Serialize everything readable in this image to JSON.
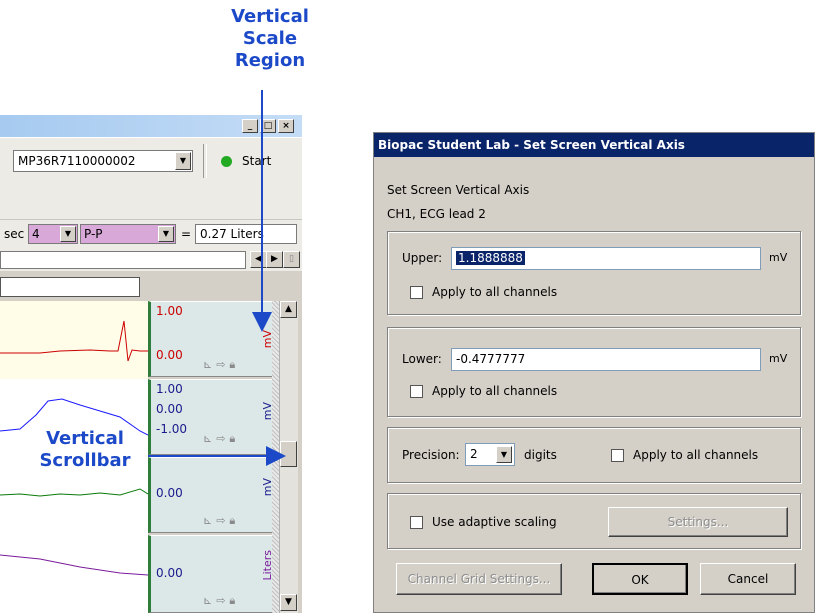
{
  "callouts": {
    "vertical_scale_region": [
      "Vertical",
      "Scale",
      "Region"
    ],
    "vertical_scrollbar": [
      "Vertical",
      "Scrollbar"
    ]
  },
  "left_app": {
    "window_controls": [
      "_",
      "□",
      "×"
    ],
    "device": "MP36R7110000002",
    "start_label": "Start",
    "measure": {
      "unit_prefix": "sec",
      "channel_value": "4",
      "measure_type": "P-P",
      "equals": "=",
      "result": "0.27 Liters"
    },
    "channels": [
      {
        "top": "1.00",
        "bottom": "0.00",
        "unit": "mV",
        "top_color": "#cc0000",
        "bottom_color": "#cc0000",
        "wave_color": "#cc0000"
      },
      {
        "top": "1.00",
        "mid": "0.00",
        "bottom": "-1.00",
        "unit": "mV",
        "wave_color": "#1a1aff"
      },
      {
        "bottom": "0.00",
        "unit": "mV",
        "wave_color": "#0a7a0a"
      },
      {
        "bottom": "0.00",
        "unit": "Liters",
        "wave_color": "#7a1a9a"
      }
    ]
  },
  "dialog": {
    "title": "Biopac Student Lab - Set Screen Vertical Axis",
    "heading": "Set Screen Vertical Axis",
    "channel": "CH1, ECG lead 2",
    "upper": {
      "label": "Upper:",
      "value": "1.1888888",
      "unit": "mV",
      "apply_label": "Apply to all channels",
      "apply_checked": false
    },
    "lower": {
      "label": "Lower:",
      "value": "-0.4777777",
      "unit": "mV",
      "apply_label": "Apply to all channels",
      "apply_checked": false
    },
    "precision": {
      "label": "Precision:",
      "value": "2",
      "suffix": "digits",
      "apply_label": "Apply to all channels",
      "apply_checked": false
    },
    "adaptive": {
      "label": "Use adaptive scaling",
      "checked": false,
      "settings_button": "Settings..."
    },
    "buttons": {
      "channel_grid": "Channel Grid Settings...",
      "ok": "OK",
      "cancel": "Cancel"
    }
  },
  "colors": {
    "accent": "#1c49c8",
    "title_bar": "#0a246a",
    "channel_bar": "#2e7d3a",
    "start_dot": "#22aa22"
  }
}
